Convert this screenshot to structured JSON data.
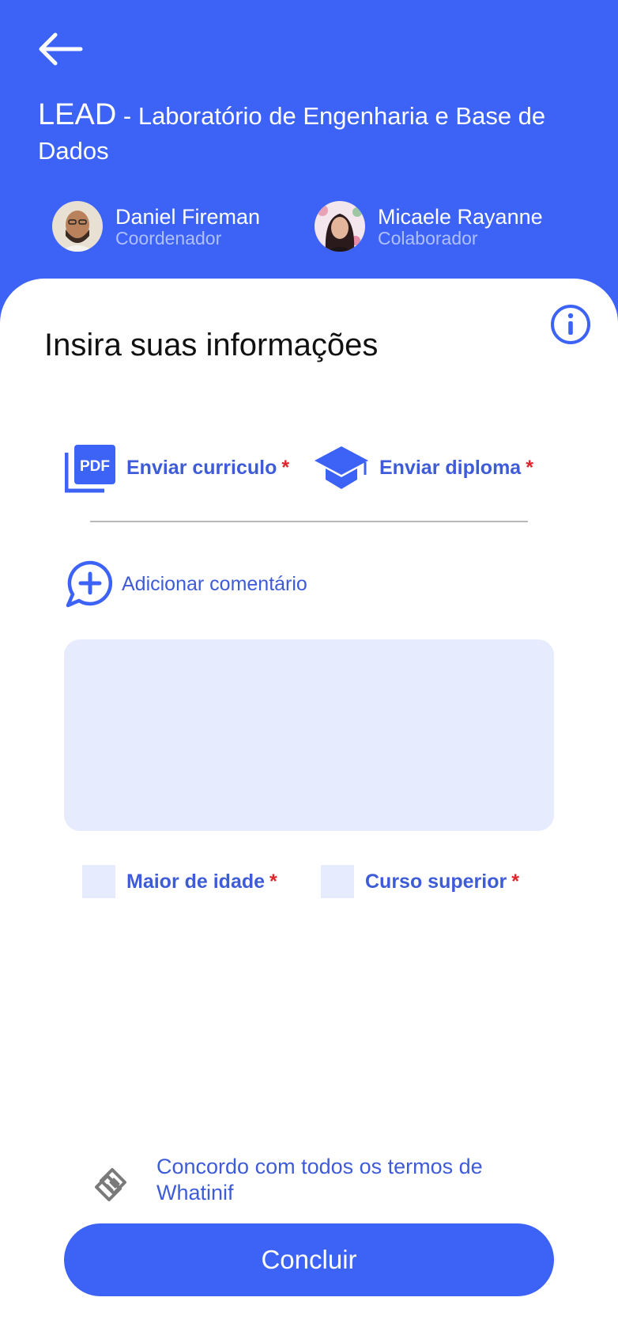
{
  "header": {
    "title_main": "LEAD",
    "title_sub": " - Laboratório de Engenharia e Base  de Dados",
    "people": [
      {
        "name": "Daniel Fireman",
        "role": "Coordenador"
      },
      {
        "name": "Micaele Rayanne",
        "role": "Colaborador"
      }
    ]
  },
  "form": {
    "section_title": "Insira suas informações",
    "uploads": [
      {
        "label": "Enviar curriculo",
        "required_mark": "*",
        "icon": "pdf-icon"
      },
      {
        "label": "Enviar diploma",
        "required_mark": "*",
        "icon": "graduation-cap-icon"
      }
    ],
    "add_comment_label": "Adicionar comentário",
    "comment_value": "",
    "checks": [
      {
        "label": "Maior de idade",
        "required_mark": "*",
        "checked": false
      },
      {
        "label": "Curso superior",
        "required_mark": "*",
        "checked": false
      }
    ],
    "terms_text": "Concordo com todos os termos de Whatinif",
    "submit_label": "Concluir"
  },
  "colors": {
    "primary": "#3D63F6",
    "text_accent": "#3E5BD8",
    "required": "#E0242B",
    "field_bg": "#E6EBFD"
  }
}
